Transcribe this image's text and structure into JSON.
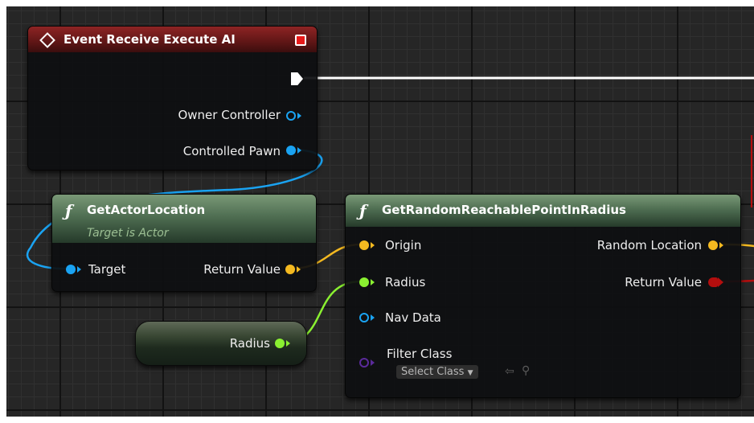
{
  "colors": {
    "canvas": "#262626",
    "event_header": "#8e2424",
    "function_header": "#4f6e52",
    "pin_object": "#1aa3f2",
    "pin_vector": "#f4b920",
    "pin_float": "#8af031",
    "pin_bool": "#b30e0e",
    "pin_class": "#5a2a9a",
    "exec_wire": "#ffffff"
  },
  "event_node": {
    "title": "Event Receive Execute AI",
    "icon": "event-diamond-icon",
    "pins": {
      "owner_controller": "Owner Controller",
      "controlled_pawn": "Controlled Pawn"
    }
  },
  "get_actor_location": {
    "title": "GetActorLocation",
    "subtitle": "Target is Actor",
    "icon": "function-icon",
    "pins": {
      "target": "Target",
      "return_value": "Return Value"
    }
  },
  "get_random_point": {
    "title": "GetRandomReachablePointInRadius",
    "icon": "function-icon",
    "pins": {
      "origin": "Origin",
      "radius": "Radius",
      "nav_data": "Nav Data",
      "filter_class": "Filter Class",
      "random_location": "Random Location",
      "return_value": "Return Value"
    },
    "select_class": "Select Class"
  },
  "radius_variable": {
    "label": "Radius"
  }
}
